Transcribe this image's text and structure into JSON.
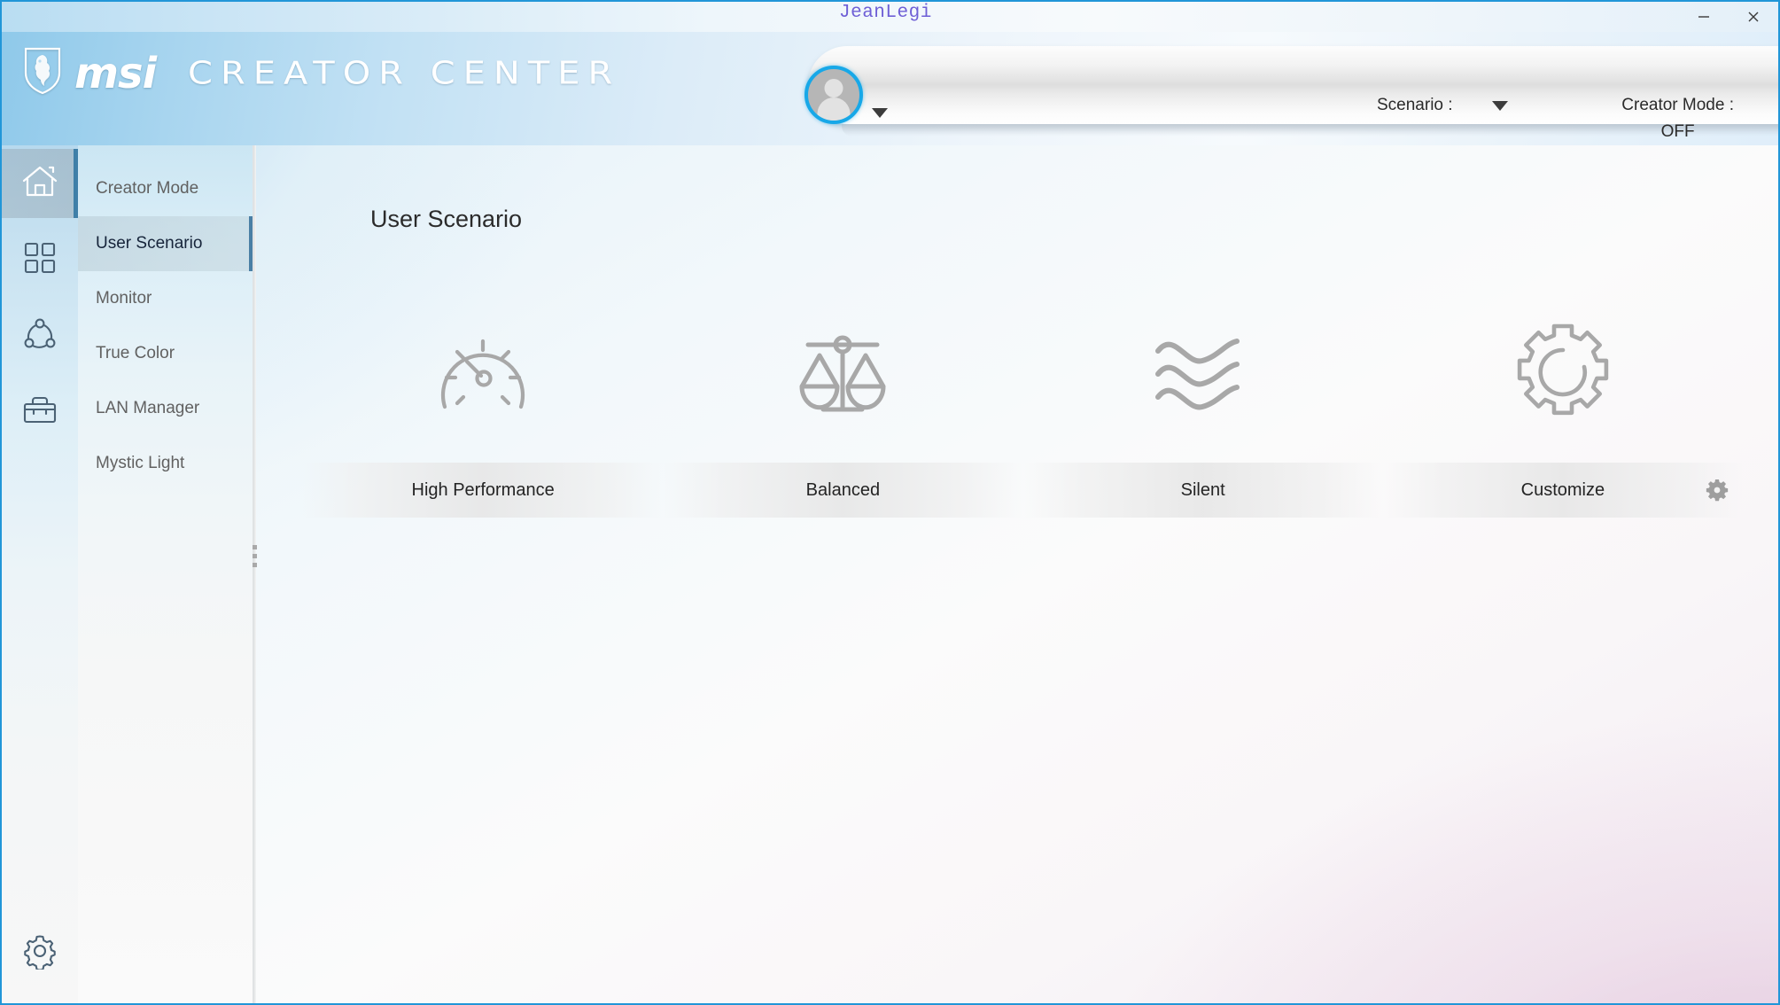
{
  "window": {
    "user_title": "JeanLegi",
    "minimize_label": "–",
    "close_label": "✕"
  },
  "header": {
    "brand_msi": "msi",
    "brand_product": "CREATOR CENTER",
    "logo_icon": "msi-dragon-shield-logo",
    "avatar_icon": "user-avatar-icon",
    "avatar_caret_icon": "chevron-down-icon",
    "scenario_label": "Scenario :",
    "scenario_caret_icon": "chevron-down-icon",
    "creator_mode_label": "Creator Mode :",
    "creator_mode_value": "OFF"
  },
  "rail": {
    "items": [
      {
        "name": "home",
        "icon": "home-icon",
        "active": true
      },
      {
        "name": "apps",
        "icon": "grid-apps-icon",
        "active": false
      },
      {
        "name": "network",
        "icon": "network-nodes-icon",
        "active": false
      },
      {
        "name": "toolbox",
        "icon": "toolbox-icon",
        "active": false
      }
    ],
    "bottom": {
      "name": "settings",
      "icon": "gear-icon"
    }
  },
  "sidebar": {
    "items": [
      {
        "label": "Creator Mode",
        "active": false
      },
      {
        "label": "User Scenario",
        "active": true
      },
      {
        "label": "Monitor",
        "active": false
      },
      {
        "label": "True Color",
        "active": false
      },
      {
        "label": "LAN Manager",
        "active": false
      },
      {
        "label": "Mystic Light",
        "active": false
      }
    ],
    "splitter_icon": "drag-handle-icon"
  },
  "main": {
    "page_title": "User Scenario",
    "scenarios": [
      {
        "label": "High Performance",
        "icon": "gauge-speedometer-icon",
        "has_gear": false
      },
      {
        "label": "Balanced",
        "icon": "balance-scale-icon",
        "has_gear": false
      },
      {
        "label": "Silent",
        "icon": "wave-lines-icon",
        "has_gear": false
      },
      {
        "label": "Customize",
        "icon": "gear-cog-icon",
        "has_gear": true,
        "gear_icon": "settings-gear-icon"
      }
    ]
  },
  "colors": {
    "accent_blue": "#2196d8",
    "avatar_ring": "#17a8e8",
    "title_user_text": "#6e5fd6",
    "nav_active_text": "#16243a",
    "nav_text": "#616161",
    "icon_gray": "#a8a8a8",
    "rail_icon": "#4b6275"
  }
}
